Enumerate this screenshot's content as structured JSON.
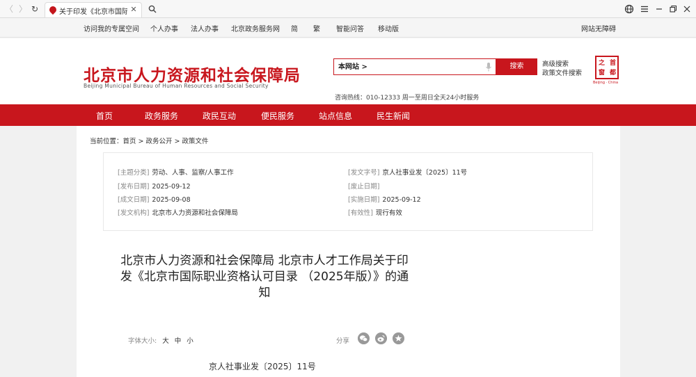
{
  "browser": {
    "tab_title": "关于印发《北京市国际职业资",
    "tab_close": "✕",
    "back": "〈",
    "forward": "〉",
    "reload": "↻"
  },
  "topbar": {
    "links": [
      "访问我的专属空间",
      "个人办事",
      "法人办事",
      "北京政务服务网",
      "简",
      "繁",
      "智能问答",
      "移动版"
    ],
    "barrier_free": "网站无障碍"
  },
  "header": {
    "title": "北京市人力资源和社会保障局",
    "subtitle": "Beijing Municipal Bureau of Human Resources and Social Security",
    "search_value": "本网站 >",
    "search_button": "搜索",
    "advanced_search": "高级搜索",
    "policy_search": "政策文件搜索",
    "hotline": "咨询热线：010-12333 周一至周日全天24小时服务",
    "seal_chars": [
      "首",
      "都",
      "之",
      "窗"
    ],
    "seal_sub": "Beijing · China"
  },
  "mainnav": [
    "首页",
    "政务服务",
    "政民互动",
    "便民服务",
    "站点信息",
    "民生新闻"
  ],
  "breadcrumb": {
    "label": "当前位置：",
    "path": "首页 > 政务公开 > 政策文件"
  },
  "meta": {
    "left": [
      {
        "key": "[主题分类]",
        "value": "劳动、人事、监察/人事工作"
      },
      {
        "key": "[发布日期]",
        "value": "2025-09-12"
      },
      {
        "key": "[成文日期]",
        "value": "2025-09-08"
      },
      {
        "key": "[发文机构]",
        "value": "北京市人力资源和社会保障局"
      }
    ],
    "right": [
      {
        "key": "[发文字号]",
        "value": "京人社事业发〔2025〕11号"
      },
      {
        "key": "[废止日期]",
        "value": ""
      },
      {
        "key": "[实施日期]",
        "value": "2025-09-12"
      },
      {
        "key": "[有效性]",
        "value": "现行有效"
      }
    ]
  },
  "document": {
    "title": "北京市人力资源和社会保障局 北京市人才工作局关于印发《北京市国际职业资格认可目录 （2025年版）》的通知",
    "font_size_label": "字体大小:",
    "font_sizes": [
      "大",
      "中",
      "小"
    ],
    "share_label": "分享",
    "doc_number": "京人社事业发〔2025〕11号"
  },
  "colors": {
    "brand_red": "#c8161d"
  }
}
